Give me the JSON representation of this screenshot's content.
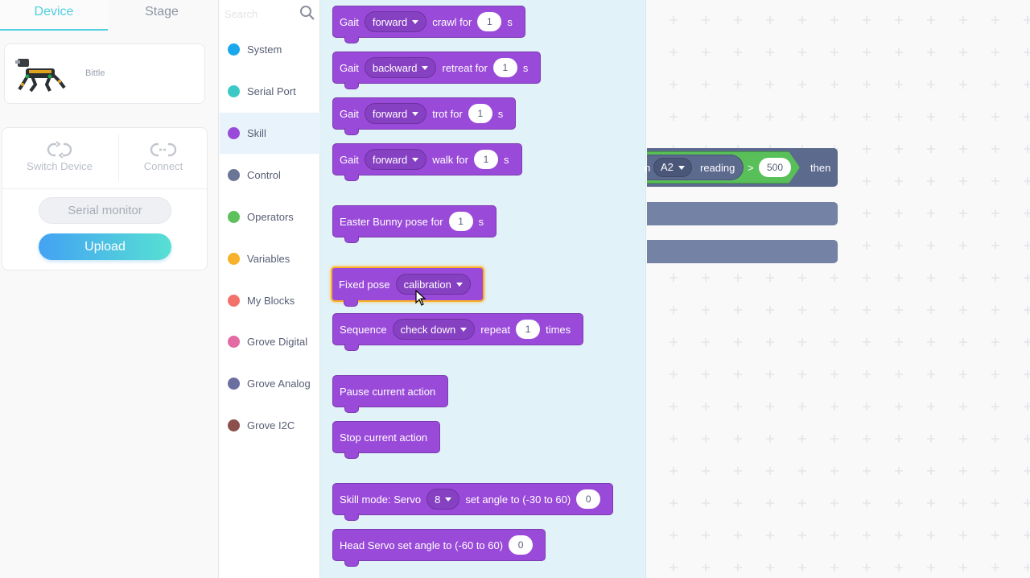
{
  "tabs": {
    "device": "Device",
    "stage": "Stage"
  },
  "device": {
    "name": "Bittle"
  },
  "controls": {
    "switch_device": "Switch Device",
    "connect": "Connect",
    "serial_monitor": "Serial monitor",
    "upload": "Upload"
  },
  "search": {
    "placeholder": "Search"
  },
  "categories": [
    {
      "label": "System",
      "color": "#1aa7ec"
    },
    {
      "label": "Serial Port",
      "color": "#3cc9c6"
    },
    {
      "label": "Skill",
      "color": "#9a4ad9",
      "selected": true
    },
    {
      "label": "Control",
      "color": "#6b7596"
    },
    {
      "label": "Operators",
      "color": "#5cc15c"
    },
    {
      "label": "Variables",
      "color": "#f6b22b"
    },
    {
      "label": "My Blocks",
      "color": "#f2726b"
    },
    {
      "label": "Grove Digital",
      "color": "#e36aa2"
    },
    {
      "label": "Grove Analog",
      "color": "#6a6fa0"
    },
    {
      "label": "Grove I2C",
      "color": "#8c4f4b"
    }
  ],
  "blocks": {
    "gait1": {
      "t1": "Gait",
      "dd": "forward",
      "t2": "crawl for",
      "num": "1",
      "t3": "s"
    },
    "gait2": {
      "t1": "Gait",
      "dd": "backward",
      "t2": "retreat for",
      "num": "1",
      "t3": "s"
    },
    "gait3": {
      "t1": "Gait",
      "dd": "forward",
      "t2": "trot for",
      "num": "1",
      "t3": "s"
    },
    "gait4": {
      "t1": "Gait",
      "dd": "forward",
      "t2": "walk for",
      "num": "1",
      "t3": "s"
    },
    "easter": {
      "t1": "Easter Bunny pose for",
      "num": "1",
      "t2": "s"
    },
    "fixed": {
      "t1": "Fixed pose",
      "dd": "calibration"
    },
    "sequence": {
      "t1": "Sequence",
      "dd": "check down",
      "t2": "repeat",
      "num": "1",
      "t3": "times"
    },
    "pause": {
      "t1": "Pause current action"
    },
    "stop": {
      "t1": "Stop current action"
    },
    "skillmode": {
      "t1": "Skill mode: Servo",
      "dd": "8",
      "t2": "set angle to (-30 to 60)",
      "num": "0"
    },
    "head": {
      "t1": "Head Servo set angle to (-60 to 60)",
      "num": "0"
    }
  },
  "workspace": {
    "if_prefix": "n",
    "reporter_dd": "A2",
    "reporter_text": "reading",
    "op": ">",
    "value": "500",
    "then": "then"
  }
}
